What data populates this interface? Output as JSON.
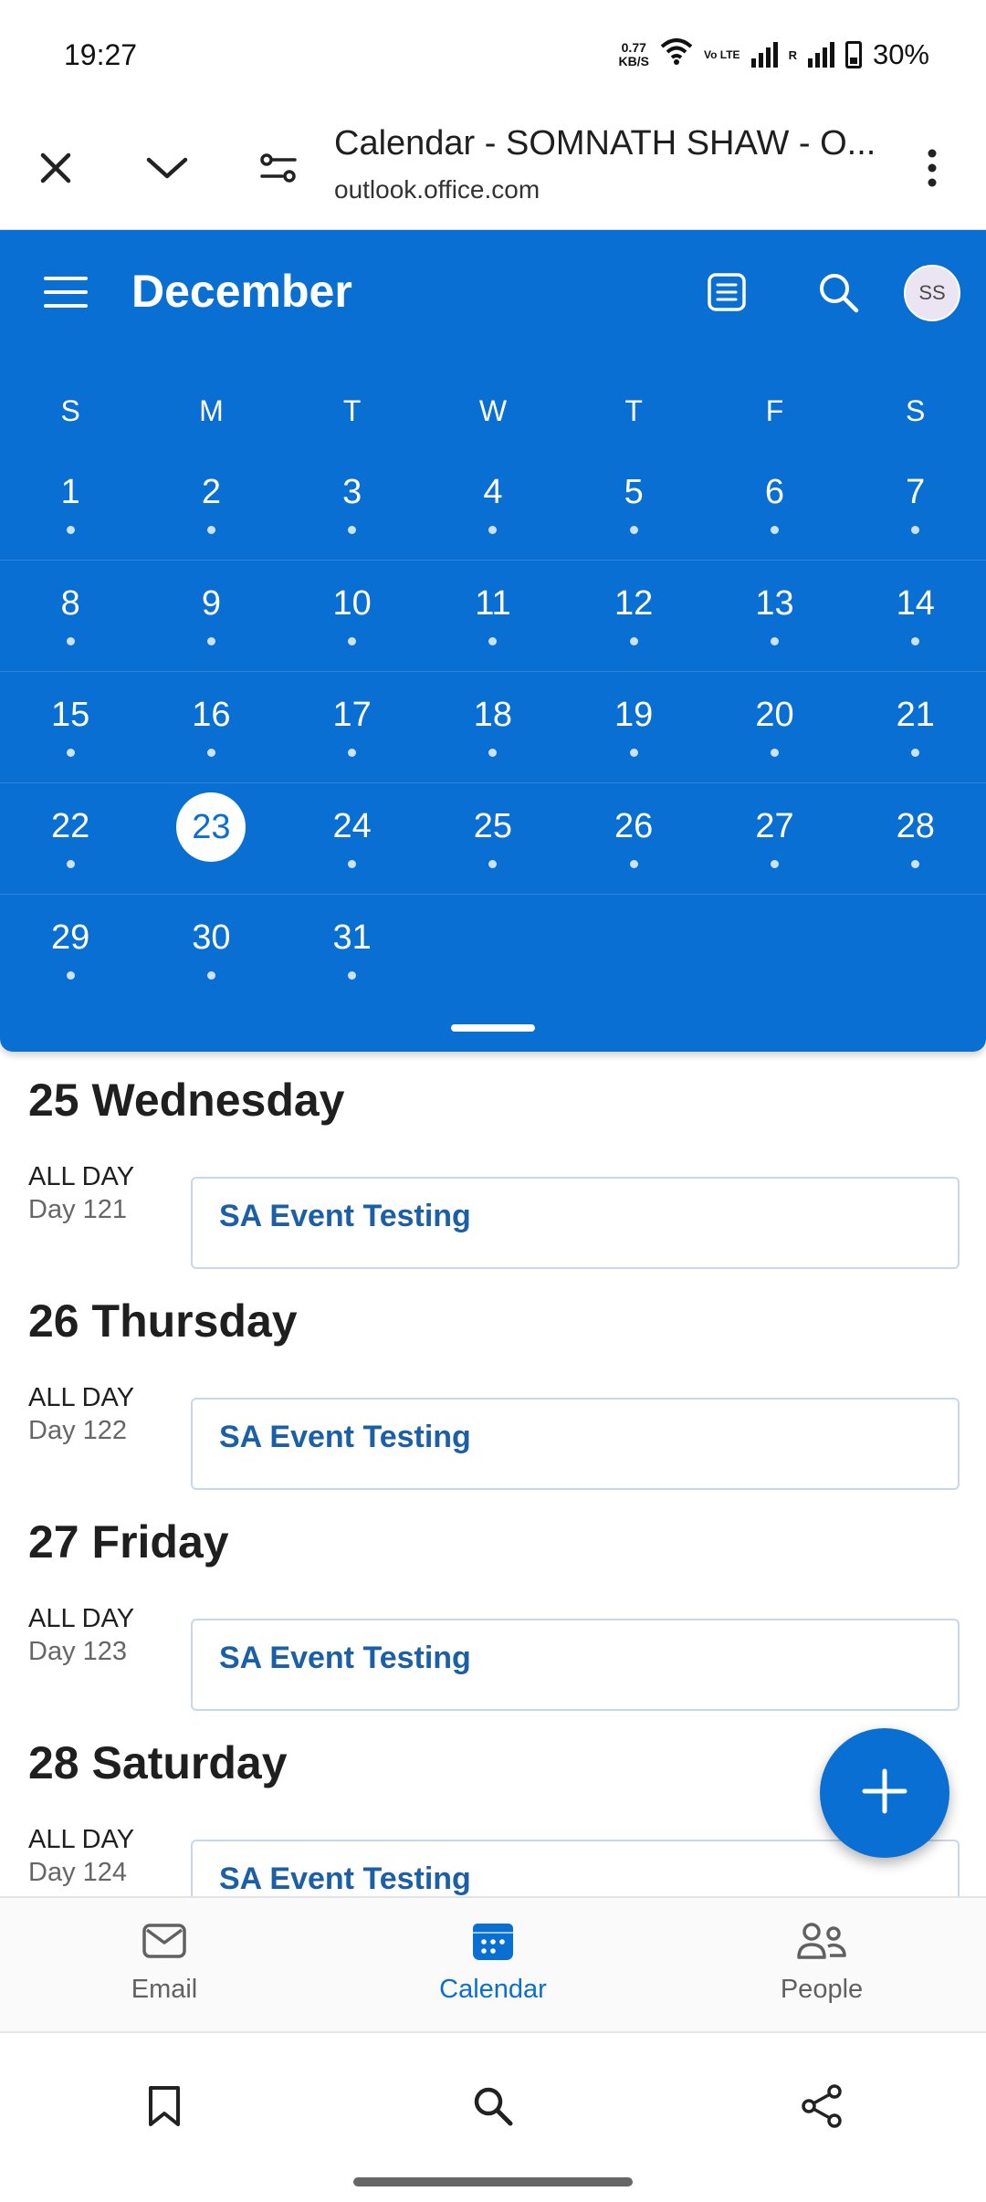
{
  "status_bar": {
    "time": "19:27",
    "net_speed_value": "0.77",
    "net_speed_unit": "KB/S",
    "volte_label": "Vo LTE",
    "roaming_label": "R",
    "battery": "30%"
  },
  "browser": {
    "title": "Calendar - SOMNATH SHAW - O...",
    "url": "outlook.office.com"
  },
  "calendar": {
    "month": "December",
    "avatar_initials": "SS",
    "weekdays": [
      "S",
      "M",
      "T",
      "W",
      "T",
      "F",
      "S"
    ],
    "weeks": [
      [
        "1",
        "2",
        "3",
        "4",
        "5",
        "6",
        "7"
      ],
      [
        "8",
        "9",
        "10",
        "11",
        "12",
        "13",
        "14"
      ],
      [
        "15",
        "16",
        "17",
        "18",
        "19",
        "20",
        "21"
      ],
      [
        "22",
        "23",
        "24",
        "25",
        "26",
        "27",
        "28"
      ],
      [
        "29",
        "30",
        "31",
        "",
        "",
        "",
        ""
      ]
    ],
    "today": "23"
  },
  "agenda": [
    {
      "day_number": "25",
      "weekday": "Wednesday",
      "all_day": "ALL DAY",
      "day_count": "Day 121",
      "event": "SA Event Testing"
    },
    {
      "day_number": "26",
      "weekday": "Thursday",
      "all_day": "ALL DAY",
      "day_count": "Day 122",
      "event": "SA Event Testing"
    },
    {
      "day_number": "27",
      "weekday": "Friday",
      "all_day": "ALL DAY",
      "day_count": "Day 123",
      "event": "SA Event Testing"
    },
    {
      "day_number": "28",
      "weekday": "Saturday",
      "all_day": "ALL DAY",
      "day_count": "Day 124",
      "event": "SA Event Testing"
    }
  ],
  "app_nav": {
    "email": "Email",
    "calendar": "Calendar",
    "people": "People"
  },
  "colors": {
    "brand": "#0a6fd3",
    "event_text": "#1a5fa8"
  },
  "icons": {
    "close": "close-icon",
    "collapse": "chevron-down-icon",
    "site_settings": "tune-icon",
    "more": "more-vertical-icon",
    "menu": "hamburger-menu-icon",
    "agenda_view": "list-view-icon",
    "search": "search-icon",
    "add": "plus-icon",
    "bookmark": "bookmark-icon",
    "share": "share-icon"
  }
}
